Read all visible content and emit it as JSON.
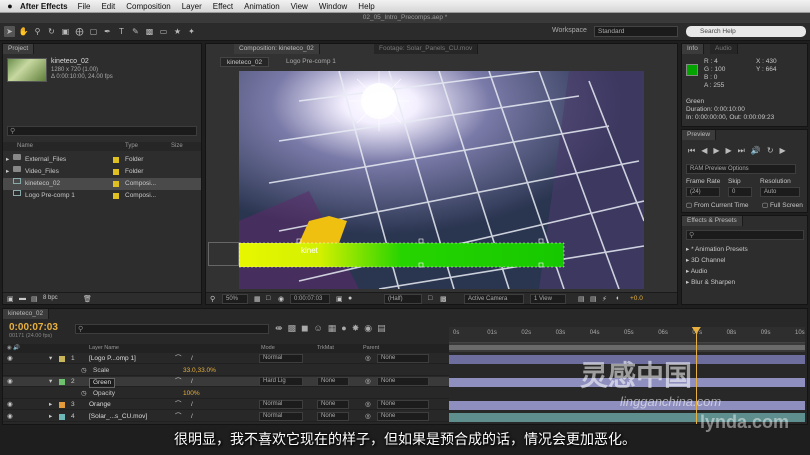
{
  "menubar": {
    "apple": "",
    "app": "After Effects",
    "items": [
      "File",
      "Edit",
      "Composition",
      "Layer",
      "Effect",
      "Animation",
      "View",
      "Window",
      "Help"
    ]
  },
  "window_title": "02_05_Intro_Precomps.aep *",
  "toolbar": {
    "workspace_label": "Workspace",
    "workspace_value": "Standard",
    "search_placeholder": "Search Help"
  },
  "project": {
    "tab": "Project",
    "thumb_name": "kineteco_02",
    "thumb_res": "1280 x 720 (1.00)",
    "thumb_dur": "Δ 0:00:10:00, 24.00 fps",
    "search_placeholder": "",
    "col_name": "Name",
    "col_type": "Type",
    "col_size": "Size",
    "items": [
      {
        "name": "External_Files",
        "type": "Folder",
        "icon": "folder-icon",
        "color": "#e0c020"
      },
      {
        "name": "Video_Files",
        "type": "Folder",
        "icon": "folder-icon",
        "color": "#e0c020"
      },
      {
        "name": "kineteco_02",
        "type": "Composi...",
        "icon": "composition-icon",
        "color": "#e0c020"
      },
      {
        "name": "Logo Pre-comp 1",
        "type": "Composi...",
        "icon": "composition-icon",
        "color": "#e0c020"
      }
    ],
    "bpc": "8 bpc"
  },
  "viewer": {
    "tab_comp": "Composition: kineteco_02",
    "tab_footage": "Footage: Solar_Panels_CU.mov",
    "crumb1": "kineteco_02",
    "crumb2": "Logo Pre-comp 1",
    "zoom": "50%",
    "timecode": "0:00:07:03",
    "resolution": "(Half)",
    "camera": "Active Camera",
    "views": "1 View",
    "exposure": "+0.0",
    "overlay_text": "kinet"
  },
  "info": {
    "tab": "Info",
    "tab2": "Audio",
    "r": "R : 4",
    "g": "G : 100",
    "b": "B : 0",
    "a": "A : 255",
    "x": "X : 430",
    "y": "Y : 664",
    "layer": "Green",
    "duration": "Duration: 0:00:10:00",
    "inout": "In: 0:00:00:00, Out: 0:00:09:23",
    "color": "#04a400"
  },
  "preview": {
    "tab": "Preview",
    "ram": "RAM Preview Options",
    "frame_rate_label": "Frame Rate",
    "skip_label": "Skip",
    "resolution_label": "Resolution",
    "frame_rate": "(24)",
    "skip": "0",
    "resolution": "Auto",
    "from_current": "From Current Time",
    "full_screen": "Full Screen"
  },
  "effects": {
    "tab": "Effects & Presets",
    "items": [
      "* Animation Presets",
      "3D Channel",
      "Audio",
      "Blur & Sharpen"
    ]
  },
  "timeline": {
    "tab": "kineteco_02",
    "timecode": "0:00:07:03",
    "frames": "00171 (24.00 fps)",
    "col_layer": "Layer Name",
    "col_mode": "Mode",
    "col_trkmat": "TrkMat",
    "col_parent": "Parent",
    "ruler": [
      "0s",
      "01s",
      "02s",
      "03s",
      "04s",
      "05s",
      "06s",
      "07s",
      "08s",
      "09s",
      "10s"
    ],
    "playhead": 0.71,
    "layers": [
      {
        "num": "1",
        "name": "[Logo P...omp 1]",
        "mode": "Normal",
        "trkmat": "",
        "parent": "None",
        "color": "#c9b55a",
        "bar": "#6e6e9e"
      },
      {
        "num": "",
        "name": "Scale",
        "mode": "",
        "trkmat": "",
        "parent": "",
        "color": "",
        "bar": "",
        "value": "33.0,33.0%"
      },
      {
        "num": "2",
        "name": "Green",
        "mode": "Hard Lig",
        "trkmat": "None",
        "parent": "None",
        "color": "#6ec26e",
        "bar": "#8f8fbf"
      },
      {
        "num": "",
        "name": "Opacity",
        "mode": "",
        "trkmat": "",
        "parent": "",
        "color": "",
        "bar": "",
        "value": "100%"
      },
      {
        "num": "3",
        "name": "Orange",
        "mode": "Normal",
        "trkmat": "None",
        "parent": "None",
        "color": "#e49a3a",
        "bar": "#8f8fbf"
      },
      {
        "num": "4",
        "name": "[Solar_...s_CU.mov]",
        "mode": "Normal",
        "trkmat": "None",
        "parent": "None",
        "color": "#6fb8b8",
        "bar": "#5e8e8e"
      }
    ]
  },
  "subtitle": "很明显，我不喜欢它现在的样子，但如果是预合成的话，情况会更加恶化。",
  "watermark": "灵感中国",
  "watermark_url": "lingganchina.com",
  "lynda": "lynda.com"
}
